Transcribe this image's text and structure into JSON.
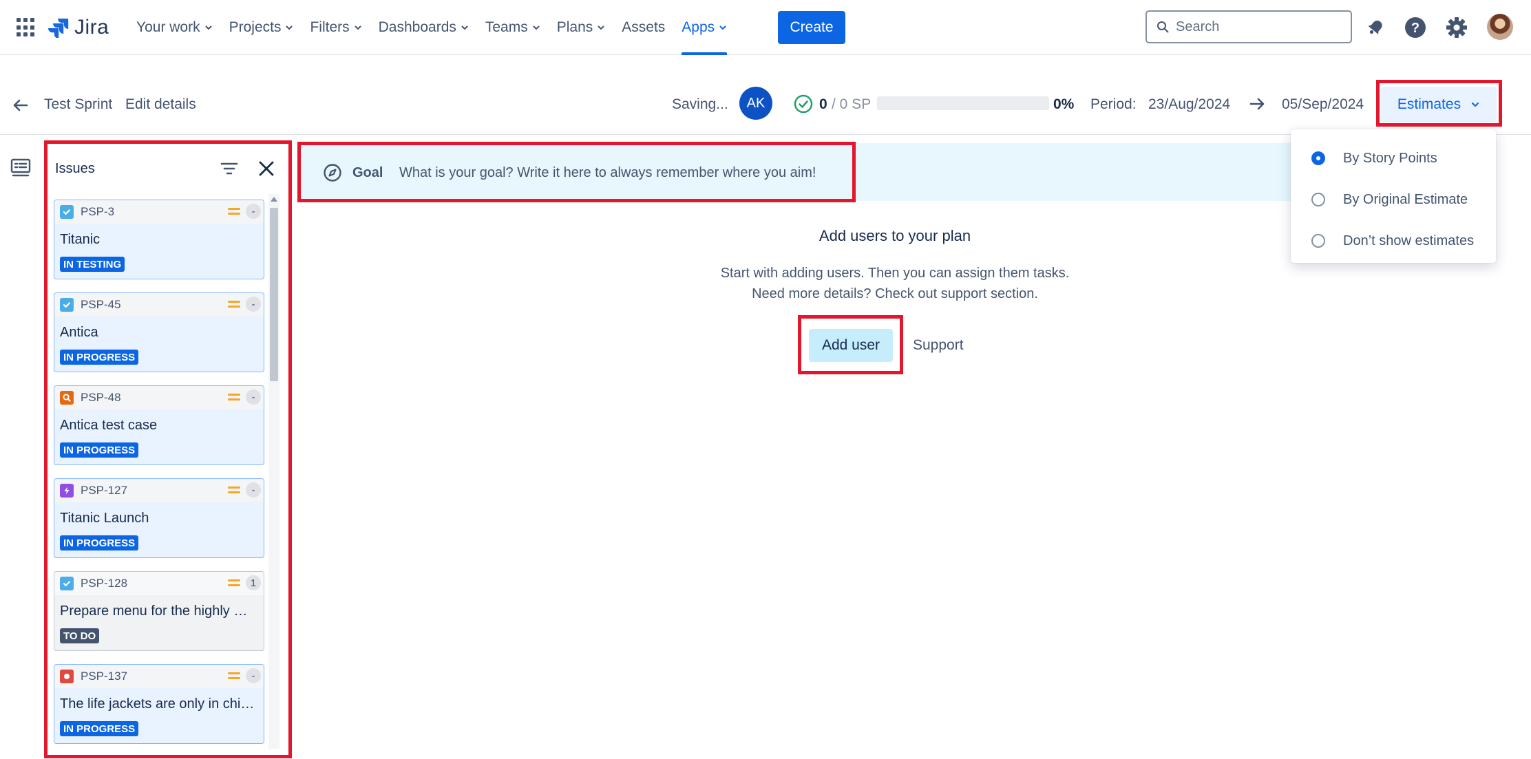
{
  "topnav": {
    "logo_text": "Jira",
    "items": [
      {
        "label": "Your work",
        "has_chevron": true
      },
      {
        "label": "Projects",
        "has_chevron": true
      },
      {
        "label": "Filters",
        "has_chevron": true
      },
      {
        "label": "Dashboards",
        "has_chevron": true
      },
      {
        "label": "Teams",
        "has_chevron": true
      },
      {
        "label": "Plans",
        "has_chevron": true
      },
      {
        "label": "Assets",
        "has_chevron": false
      },
      {
        "label": "Apps",
        "has_chevron": true,
        "active": true
      }
    ],
    "create_label": "Create",
    "search_placeholder": "Search",
    "icons": [
      "app-switcher-icon",
      "jira-logo-icon",
      "search-icon",
      "notifications-icon",
      "help-icon",
      "settings-icon",
      "profile-avatar"
    ]
  },
  "sprint": {
    "name": "Test Sprint",
    "edit_label": "Edit details",
    "saving_text": "Saving...",
    "assignee_initials": "AK",
    "points_done": "0",
    "points_total": "/ 0 SP",
    "progress_fraction": 0,
    "progress_pct": "0%",
    "period_label": "Period:",
    "period_start": "23/Aug/2024",
    "period_end": "05/Sep/2024",
    "estimates_label": "Estimates"
  },
  "estimates_menu": [
    {
      "label": "By Story Points",
      "checked": true
    },
    {
      "label": "By Original Estimate",
      "checked": false
    },
    {
      "label": "Don’t show estimates",
      "checked": false
    }
  ],
  "issues": {
    "title": "Issues",
    "cards": [
      {
        "key": "PSP-3",
        "type": "task",
        "title": "Titanic",
        "status": "IN TESTING",
        "estimate": "-"
      },
      {
        "key": "PSP-45",
        "type": "task",
        "title": "Antica",
        "status": "IN PROGRESS",
        "estimate": "-"
      },
      {
        "key": "PSP-48",
        "type": "test",
        "title": "Antica test case",
        "status": "IN PROGRESS",
        "estimate": "-"
      },
      {
        "key": "PSP-127",
        "type": "epic",
        "title": "Titanic Launch",
        "status": "IN PROGRESS",
        "estimate": "-"
      },
      {
        "key": "PSP-128",
        "type": "task",
        "title": "Prepare menu for the highly …",
        "status": "TO DO",
        "estimate": "1"
      },
      {
        "key": "PSP-137",
        "type": "bug",
        "title": "The life jackets are only in chi…",
        "status": "IN PROGRESS",
        "estimate": "-"
      }
    ]
  },
  "goal": {
    "label": "Goal",
    "placeholder": "What is your goal? Write it here to always remember where you aim!"
  },
  "empty_state": {
    "title": "Add users to your plan",
    "line1": "Start with adding users. Then you can assign them tasks.",
    "line2": "Need more details? Check out support section.",
    "add_user_label": "Add user",
    "support_label": "Support"
  },
  "colors": {
    "accent": "#0c66e4",
    "annotation_red": "#e2162c",
    "goal_bg": "#e7f7fd",
    "card_bg": "#e9f2ff"
  }
}
